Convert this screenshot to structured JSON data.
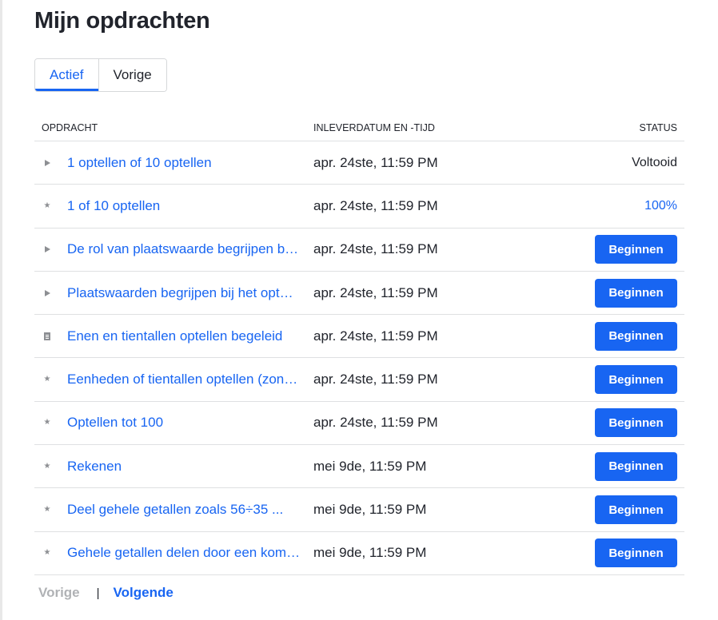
{
  "page": {
    "title": "Mijn opdrachten"
  },
  "tabs": [
    {
      "label": "Actief",
      "active": true
    },
    {
      "label": "Vorige",
      "active": false
    }
  ],
  "table": {
    "headers": {
      "assignment": "OPDRACHT",
      "due": "INLEVERDATUM EN -TIJD",
      "status": "STATUS"
    },
    "rows": [
      {
        "icon": "play-icon",
        "title": "1 optellen of 10 optellen",
        "due": "apr. 24ste, 11:59 PM",
        "status_type": "text",
        "status": "Voltooid"
      },
      {
        "icon": "star-icon",
        "title": "1 of 10 optellen",
        "due": "apr. 24ste, 11:59 PM",
        "status_type": "score",
        "status": "100%"
      },
      {
        "icon": "play-icon",
        "title": "De rol van plaatswaarde begrijpen bij het optellen",
        "due": "apr. 24ste, 11:59 PM",
        "status_type": "button",
        "status": "Beginnen"
      },
      {
        "icon": "play-icon",
        "title": "Plaatswaarden begrijpen bij het optellen",
        "due": "apr. 24ste, 11:59 PM",
        "status_type": "button",
        "status": "Beginnen"
      },
      {
        "icon": "document-icon",
        "title": "Enen en tientallen optellen begeleid",
        "due": "apr. 24ste, 11:59 PM",
        "status_type": "button",
        "status": "Beginnen"
      },
      {
        "icon": "star-icon",
        "title": "Eenheden of tientallen optellen (zonder hergroeperen)",
        "due": "apr. 24ste, 11:59 PM",
        "status_type": "button",
        "status": "Beginnen"
      },
      {
        "icon": "star-icon",
        "title": "Optellen tot 100",
        "due": "apr. 24ste, 11:59 PM",
        "status_type": "button",
        "status": "Beginnen"
      },
      {
        "icon": "star-icon",
        "title": "Rekenen",
        "due": "mei 9de, 11:59 PM",
        "status_type": "button",
        "status": "Beginnen"
      },
      {
        "icon": "star-icon",
        "title": "Deel gehele getallen zoals 56÷35 ...",
        "due": "mei 9de, 11:59 PM",
        "status_type": "button",
        "status": "Beginnen"
      },
      {
        "icon": "star-icon",
        "title": "Gehele getallen delen door een kommagetal",
        "due": "mei 9de, 11:59 PM",
        "status_type": "button",
        "status": "Beginnen"
      }
    ]
  },
  "pagination": {
    "prev": "Vorige",
    "separator": "|",
    "next": "Volgende"
  },
  "colors": {
    "accent": "#1865f2",
    "text": "#21242c",
    "muted": "#8d8f93",
    "disabled": "#b0b2b5",
    "border": "#dfe0e2"
  }
}
